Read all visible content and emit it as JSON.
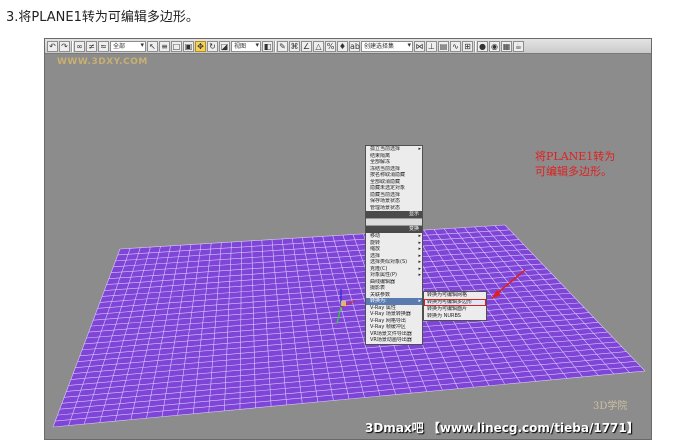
{
  "step_title": "3.将PLANE1转为可编辑多边形。",
  "app": {
    "watermark_top": "WWW.3DXY.COM",
    "toolbar": {
      "selection_filter": "全部",
      "reference_coord": "视图",
      "named_selection": "创建选择集"
    },
    "viewport": {
      "colors": {
        "background": "#8c8c8c",
        "plane": "#7f45d6",
        "grid_line": "#d9c8ff"
      }
    },
    "quad_menu": {
      "top_items": [
        "孤立当前选择",
        "结束隔离",
        "全部解冻",
        "冻结当前选择",
        "按名称取消隐藏",
        "全部取消隐藏",
        "隐藏未选定对象",
        "隐藏当前选择",
        "保存场景状态",
        "管理场景状态"
      ],
      "header_display": "显示",
      "header_transform": "变换",
      "bottom_items": [
        "移动",
        "旋转",
        "缩放",
        "选择",
        "选择类似对象(S)",
        "克隆(C)",
        "对象属性(P)",
        "曲线编辑器",
        "摄影表",
        "关联参数",
        "转换为:",
        "V-Ray 属性",
        "V-Ray 场景转换器",
        "V-Ray 网格导出",
        "V-Ray 帧缓冲区",
        "VR场景文件导出器",
        "VR场景动画导出器"
      ],
      "selected_item": "转换为:"
    },
    "submenu": {
      "items": [
        "转换为可编辑网格",
        "转换为可编辑多边形",
        "转换为可编辑面片",
        "转换为 NURBS"
      ],
      "highlighted": "转换为可编辑多边形"
    },
    "annotation": "将PLANE1转为可编辑多边形。",
    "watermark_bottom": "3Dmax吧 【www.linecg.com/tieba/1771】",
    "logo_badge": "3D学院"
  }
}
